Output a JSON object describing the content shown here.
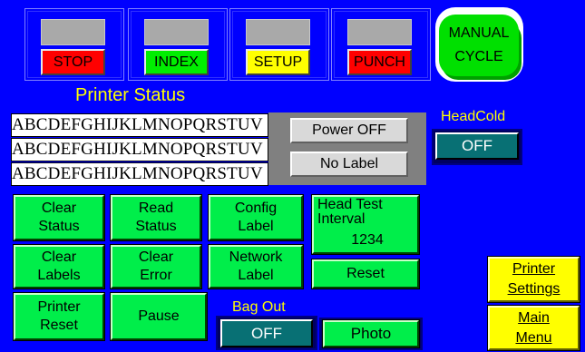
{
  "mode_buttons": [
    {
      "label": "STOP",
      "color": "#ff0000"
    },
    {
      "label": "INDEX",
      "color": "#00ee00"
    },
    {
      "label": "SETUP",
      "color": "#ffff00"
    },
    {
      "label": "PUNCH",
      "color": "#ff0000"
    }
  ],
  "manual_cycle": {
    "line1": "MANUAL",
    "line2": "CYCLE",
    "color": "#00e000"
  },
  "printer_status": {
    "title": "Printer Status",
    "lines": [
      "ABCDEFGHIJKLMNOPQRSTUV",
      "ABCDEFGHIJKLMNOPQRSTUV",
      "ABCDEFGHIJKLMNOPQRSTUV"
    ],
    "power": "Power OFF",
    "label_status": "No Label"
  },
  "head_cold": {
    "label": "HeadCold",
    "value": "OFF"
  },
  "action_buttons": {
    "clear_status": [
      "Clear",
      "Status"
    ],
    "read_status": [
      "Read",
      "Status"
    ],
    "config_label": [
      "Config",
      "Label"
    ],
    "clear_labels": [
      "Clear",
      "Labels"
    ],
    "clear_error": [
      "Clear",
      "Error"
    ],
    "network_label": [
      "Network",
      "Label"
    ],
    "printer_reset": [
      "Printer",
      "Reset"
    ],
    "pause": "Pause"
  },
  "head_test": {
    "line1": "Head Test",
    "line2": "Interval",
    "value": "1234",
    "reset": "Reset"
  },
  "bag_out": {
    "label": "Bag Out",
    "value": "OFF"
  },
  "photo": "Photo",
  "nav": {
    "printer_settings": [
      "Printer",
      "Settings"
    ],
    "main_menu": [
      "Main",
      "Menu"
    ]
  },
  "colors": {
    "background": "#0000ff",
    "accent_green": "#00ee4a",
    "accent_yellow": "#ffff00",
    "indicator_teal": "#087074"
  }
}
